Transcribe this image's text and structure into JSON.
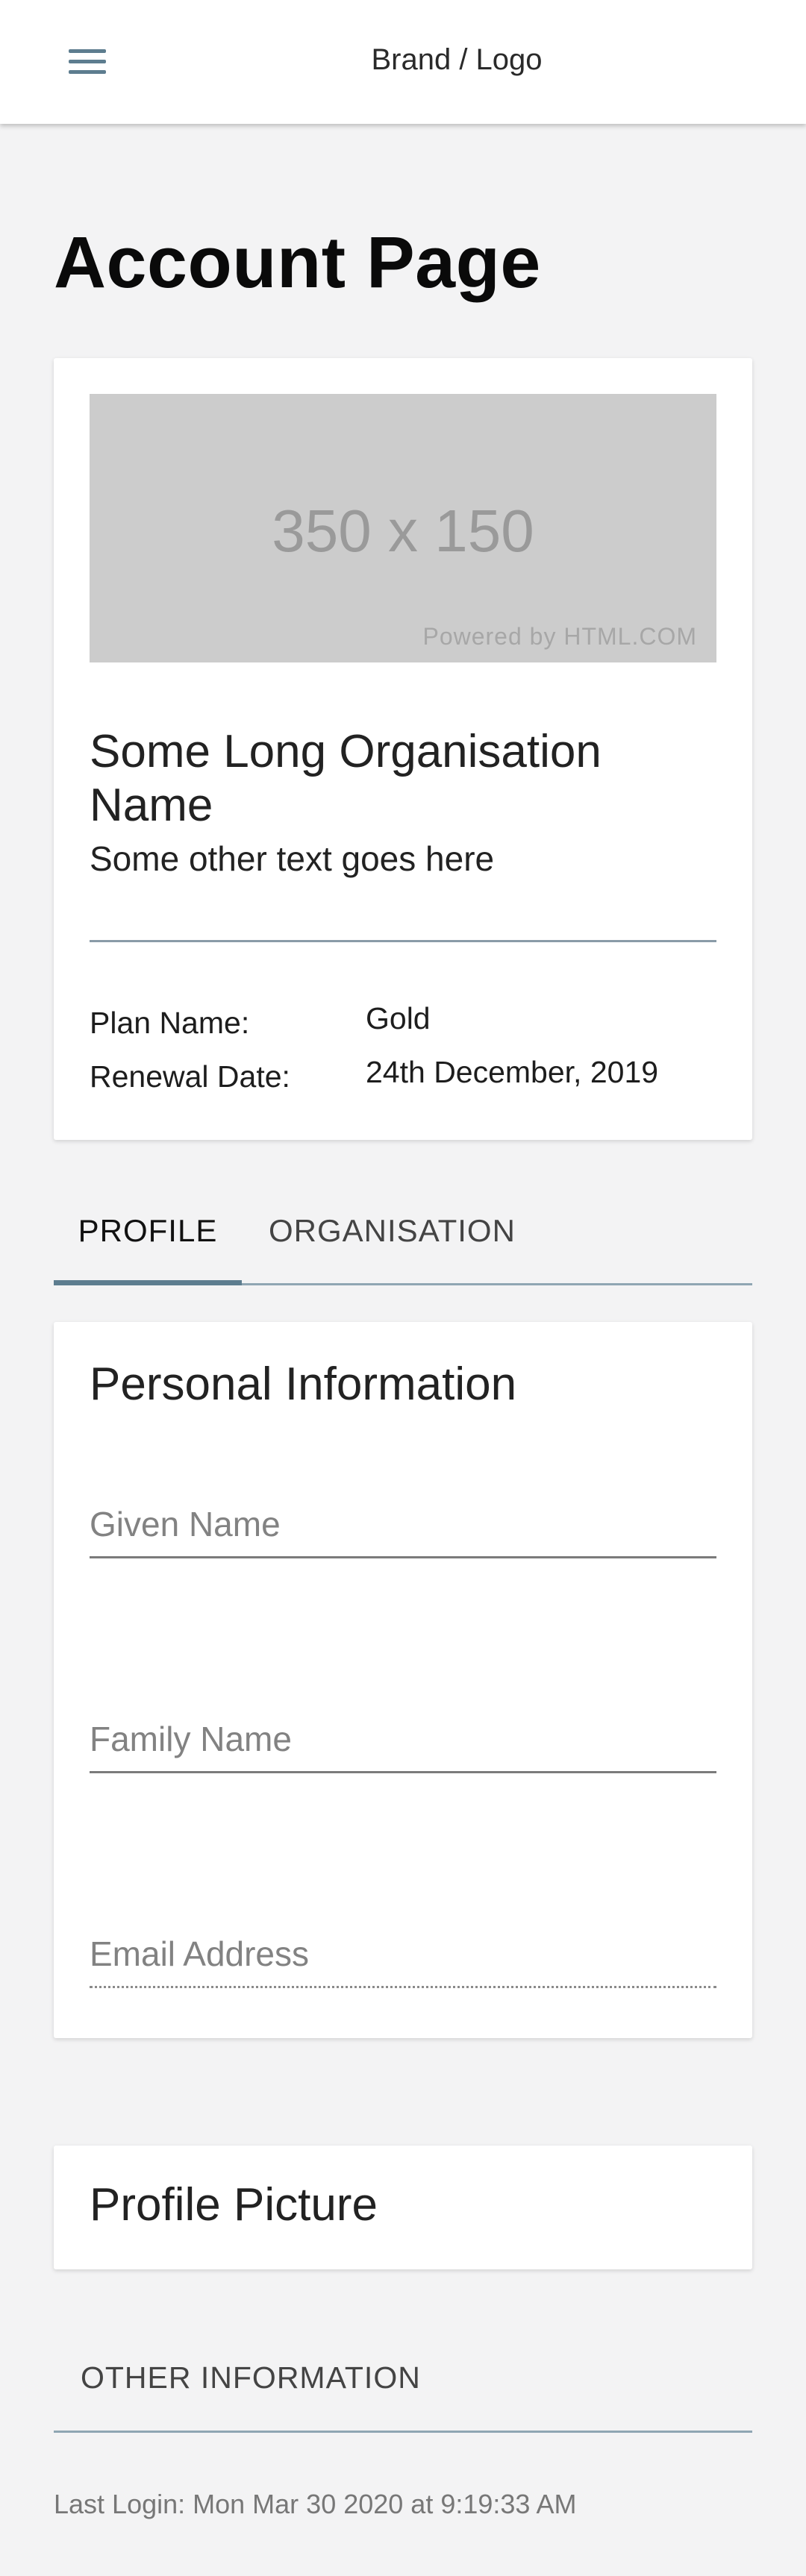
{
  "header": {
    "brand": "Brand / Logo",
    "menu_icon": "hamburger-menu-icon"
  },
  "page": {
    "title": "Account Page"
  },
  "organisation_card": {
    "image_placeholder": {
      "size_text": "350 x 150",
      "credit": "Powered by HTML.COM"
    },
    "name": "Some Long Organisation Name",
    "subtitle": "Some other text goes here",
    "plan_label": "Plan Name:",
    "plan_value": "Gold",
    "renewal_label": "Renewal Date:",
    "renewal_value": "24th December, 2019"
  },
  "tabs": [
    {
      "label": "PROFILE",
      "active": true
    },
    {
      "label": "ORGANISATION",
      "active": false
    }
  ],
  "personal_info": {
    "title": "Personal Information",
    "fields": [
      {
        "placeholder": "Given Name",
        "value": ""
      },
      {
        "placeholder": "Family Name",
        "value": ""
      },
      {
        "placeholder": "Email Address",
        "value": ""
      }
    ]
  },
  "profile_picture": {
    "title": "Profile Picture"
  },
  "other_information": {
    "label": "OTHER INFORMATION"
  },
  "footer": {
    "last_login": "Last Login: Mon Mar 30 2020 at 9:19:33 AM"
  },
  "colors": {
    "background": "#f3f3f4",
    "accent": "#5d7d8f",
    "divider": "#8fa6b3",
    "card": "#ffffff"
  }
}
